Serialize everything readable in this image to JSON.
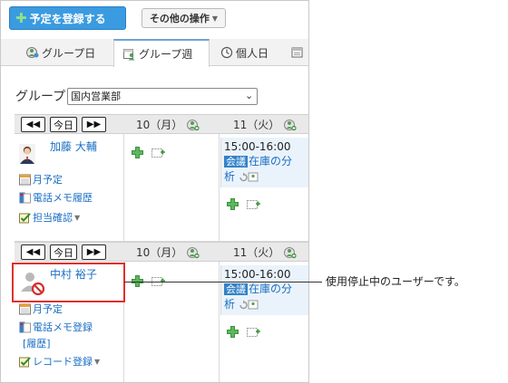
{
  "toolbar": {
    "register_label": "予定を登録する",
    "other_ops_label": "その他の操作"
  },
  "tabs": [
    {
      "label": "グループ日",
      "icon": "group-day-icon"
    },
    {
      "label": "グループ週",
      "icon": "group-week-icon",
      "active": true
    },
    {
      "label": "個人日",
      "icon": "clock-icon"
    },
    {
      "label": "",
      "icon": "calendar-icon"
    }
  ],
  "group": {
    "label": "グループ",
    "selected": "国内営業部"
  },
  "nav": {
    "prev": "◀◀",
    "today": "今日",
    "next": "▶▶"
  },
  "days": [
    {
      "label": "10（月）"
    },
    {
      "label": "11（火）"
    }
  ],
  "users": [
    {
      "name": "加藤 大輔",
      "links": {
        "month": "月予定",
        "phone": "電話メモ履歴",
        "confirm": "担当確認"
      },
      "event": {
        "time": "15:00-16:00",
        "tag": "会議",
        "title_a": "在庫の分",
        "title_b": "析"
      }
    },
    {
      "name": "中村 裕子",
      "links": {
        "month": "月予定",
        "phone": "電話メモ登録",
        "history": "[履歴]",
        "record": "レコード登録"
      },
      "event": {
        "time": "15:00-16:00",
        "tag": "会議",
        "title_a": "在庫の分",
        "title_b": "析"
      }
    }
  ],
  "callout": "使用停止中のユーザーです。",
  "colors": {
    "primary_button": "#3b9be0",
    "link": "#1a6fc4",
    "event_bg": "#eaf3fb",
    "tag_bg": "#3182c8",
    "highlight": "#e0302a"
  }
}
